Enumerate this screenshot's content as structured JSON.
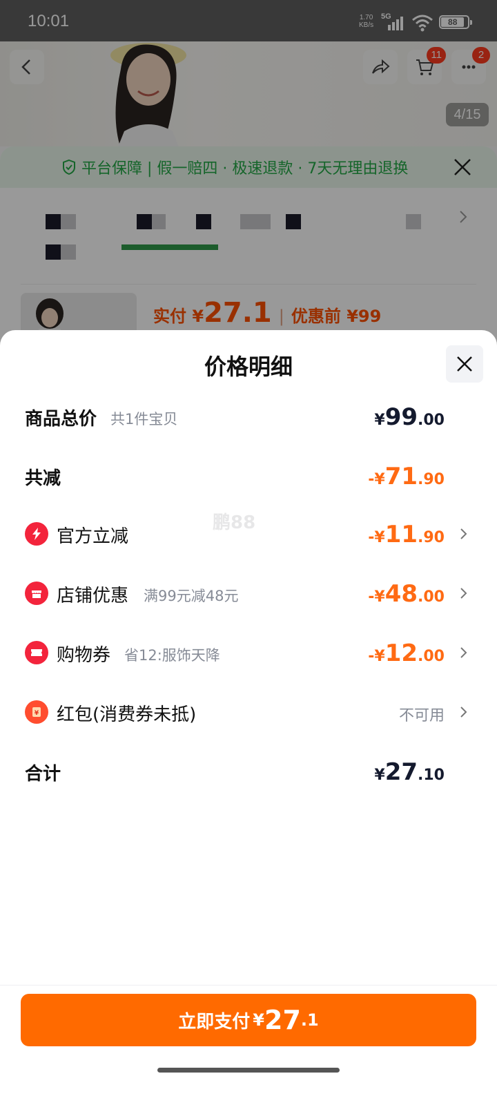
{
  "status_bar": {
    "time": "10:01",
    "net_speed_value": "1.70",
    "net_speed_unit": "KB/s",
    "network": "5G",
    "battery": "88"
  },
  "background_page": {
    "cart_badge": "11",
    "message_badge": "2",
    "image_counter": "4/15",
    "guarantee_text": "平台保障 | 假一赔四 · 极速退款 · 7天无理由退换",
    "paid_label": "实付",
    "paid_currency": "¥",
    "paid_amount": "27.1",
    "original_label": "优惠前",
    "original_amount": "¥99"
  },
  "sheet": {
    "title": "价格明细",
    "watermark": "鹏88",
    "rows": [
      {
        "label": "商品总价",
        "hint": "共1件宝贝",
        "currency": "¥",
        "int": "99",
        "dec": ".00"
      },
      {
        "label": "共减",
        "currency": "-¥",
        "int": "71",
        "dec": ".90"
      },
      {
        "label": "官方立减",
        "icon": "lightning-icon",
        "currency": "-¥",
        "int": "11",
        "dec": ".90"
      },
      {
        "label": "店铺优惠",
        "icon": "shop-icon",
        "hint": "满99元减48元",
        "currency": "-¥",
        "int": "48",
        "dec": ".00"
      },
      {
        "label": "购物券",
        "icon": "ticket-icon",
        "hint": "省12:服饰天降",
        "currency": "-¥",
        "int": "12",
        "dec": ".00"
      },
      {
        "label": "红包(消费券未抵)",
        "icon": "red-envelope-icon",
        "status": "不可用"
      },
      {
        "label": "合计",
        "currency": "¥",
        "int": "27",
        "dec": ".10"
      }
    ]
  },
  "footer": {
    "pay_label": "立即支付",
    "pay_currency": "¥",
    "pay_int": "27",
    "pay_dec": ".1"
  },
  "colors": {
    "accent_orange": "#ff6a13",
    "pay_button": "#ff6a00",
    "icon_red": "#f3243c",
    "guarantee_green": "#23a846"
  }
}
